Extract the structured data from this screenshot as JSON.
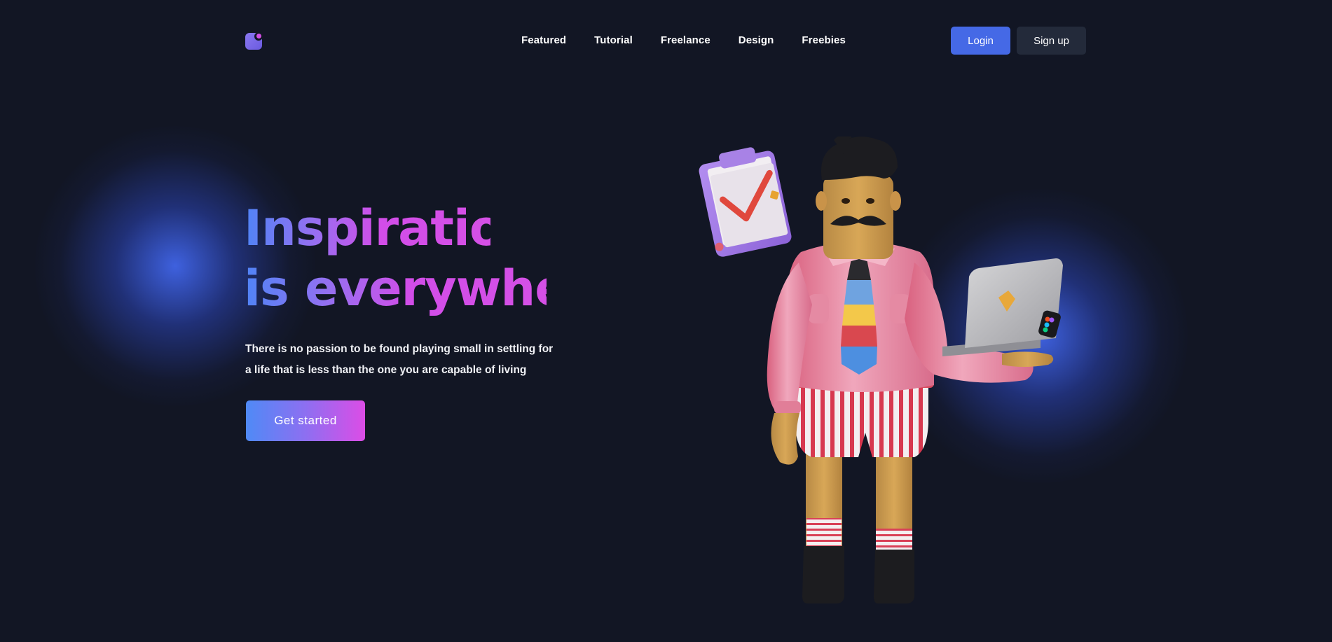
{
  "header": {
    "logo_icon": "app-logo-icon",
    "nav": [
      {
        "label": "Featured"
      },
      {
        "label": "Tutorial"
      },
      {
        "label": "Freelance"
      },
      {
        "label": "Design"
      },
      {
        "label": "Freebies"
      }
    ],
    "login_label": "Login",
    "signup_label": "Sign up"
  },
  "hero": {
    "title_line1": "Inspiration",
    "title_line2": "is everywhere",
    "subtitle_line1": "There is no passion to be found playing small in settling for",
    "subtitle_line2": "a life that is less than the one you are capable of living",
    "cta_label": "Get started",
    "illustration": "3d-character-with-laptop-and-clipboard"
  },
  "colors": {
    "background": "#121624",
    "accent_blue": "#4569e6",
    "gradient_start": "#4f84f6",
    "gradient_end": "#dc4de6",
    "secondary_button": "#232a3a"
  }
}
